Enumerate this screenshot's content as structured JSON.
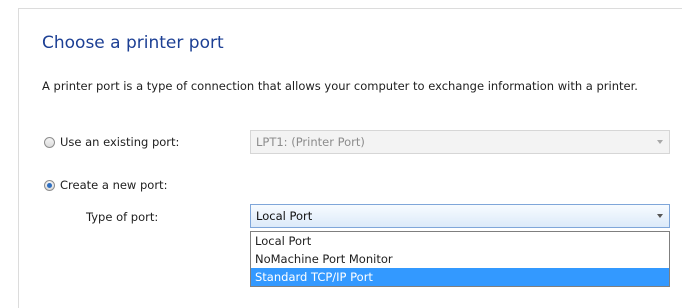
{
  "page": {
    "title": "Choose a printer port",
    "description": "A printer port is a type of connection that allows your computer to exchange information with a printer."
  },
  "existing_port": {
    "label": "Use an existing port:",
    "selected": false,
    "value": "LPT1: (Printer Port)"
  },
  "new_port": {
    "label": "Create a new port:",
    "selected": true,
    "type_label": "Type of port:",
    "value": "Local Port",
    "options": [
      {
        "label": "Local Port",
        "highlighted": false
      },
      {
        "label": "NoMachine Port Monitor",
        "highlighted": false
      },
      {
        "label": "Standard TCP/IP Port",
        "highlighted": true
      }
    ]
  },
  "colors": {
    "title": "#1c3f94",
    "highlight": "#3399ff"
  }
}
